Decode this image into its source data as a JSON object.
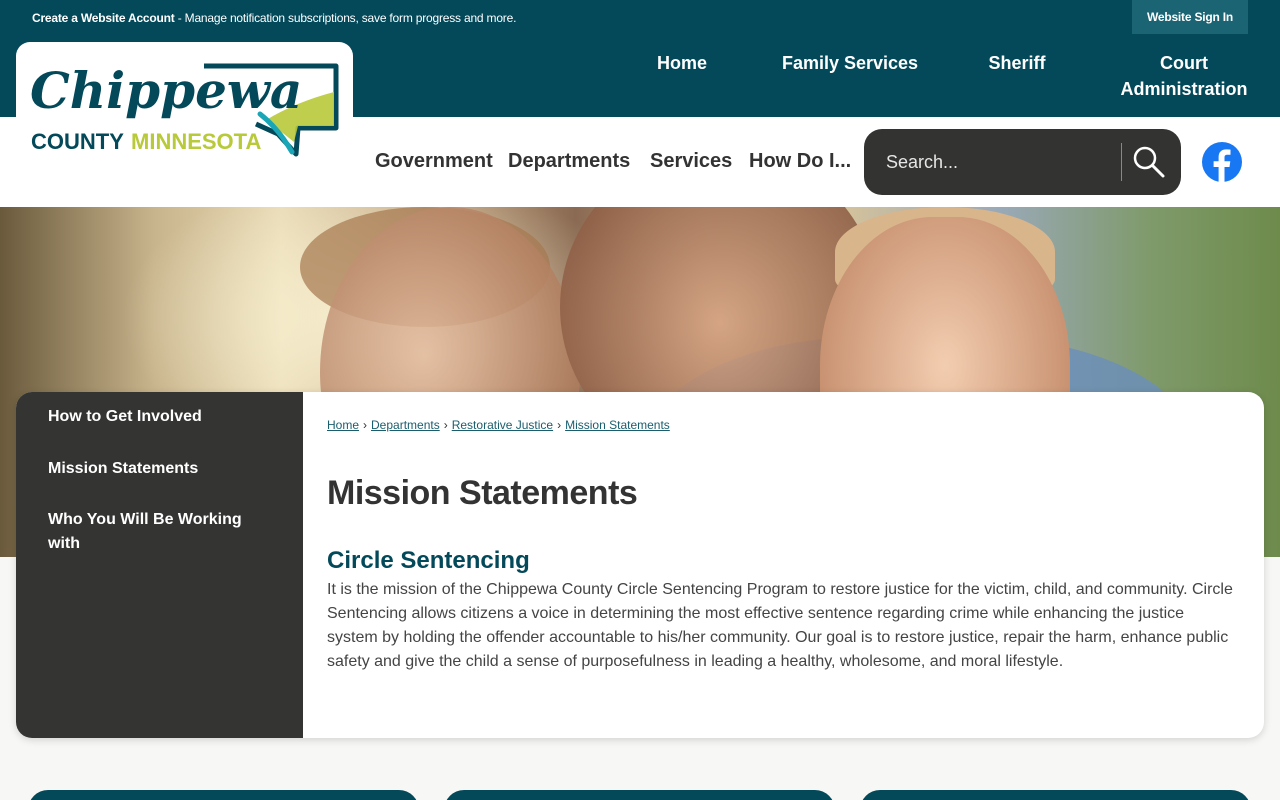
{
  "topbar": {
    "notice_bold": "Create a Website Account",
    "notice_text": " - Manage notification subscriptions, save form progress and more.",
    "signin_label": "Website Sign In"
  },
  "logo": {
    "script_text": "Chippewa",
    "county_text": "COUNTY",
    "state_text": "MINNESOTA"
  },
  "top_nav": [
    {
      "label": "Home"
    },
    {
      "label": "Family Services"
    },
    {
      "label": "Sheriff"
    },
    {
      "label": "Court"
    },
    {
      "label": "Administration"
    }
  ],
  "main_nav": [
    {
      "label": "Government"
    },
    {
      "label": "Departments"
    },
    {
      "label": "Services"
    },
    {
      "label": "How Do I..."
    }
  ],
  "search": {
    "placeholder": "Search...",
    "icon": "magnifier-icon"
  },
  "social": {
    "icon": "facebook-icon"
  },
  "sidebar": {
    "items": [
      {
        "label": "How to Get Involved"
      },
      {
        "label": "Mission Statements"
      },
      {
        "label": "Who You Will Be Working with"
      }
    ]
  },
  "breadcrumb": {
    "items": [
      {
        "label": "Home"
      },
      {
        "label": "Departments"
      },
      {
        "label": "Restorative Justice"
      },
      {
        "label": "Mission Statements"
      }
    ],
    "separator": "›"
  },
  "content": {
    "title": "Mission Statements",
    "section_title": "Circle Sentencing",
    "paragraph": "It is the mission of the Chippewa County Circle Sentencing Program to restore justice for the victim, child, and community. Circle Sentencing allows citizens a voice in determining the most effective sentence regarding crime while enhancing the justice system by holding the offender accountable to his/her community. Our goal is to restore justice, repair the harm, enhance public safety and give the child a sense of purposefulness in leading a healthy, wholesome, and moral lifestyle."
  },
  "colors": {
    "brand_teal": "#03495a",
    "dark_gray": "#343533",
    "logo_lime": "#b8c93a"
  }
}
